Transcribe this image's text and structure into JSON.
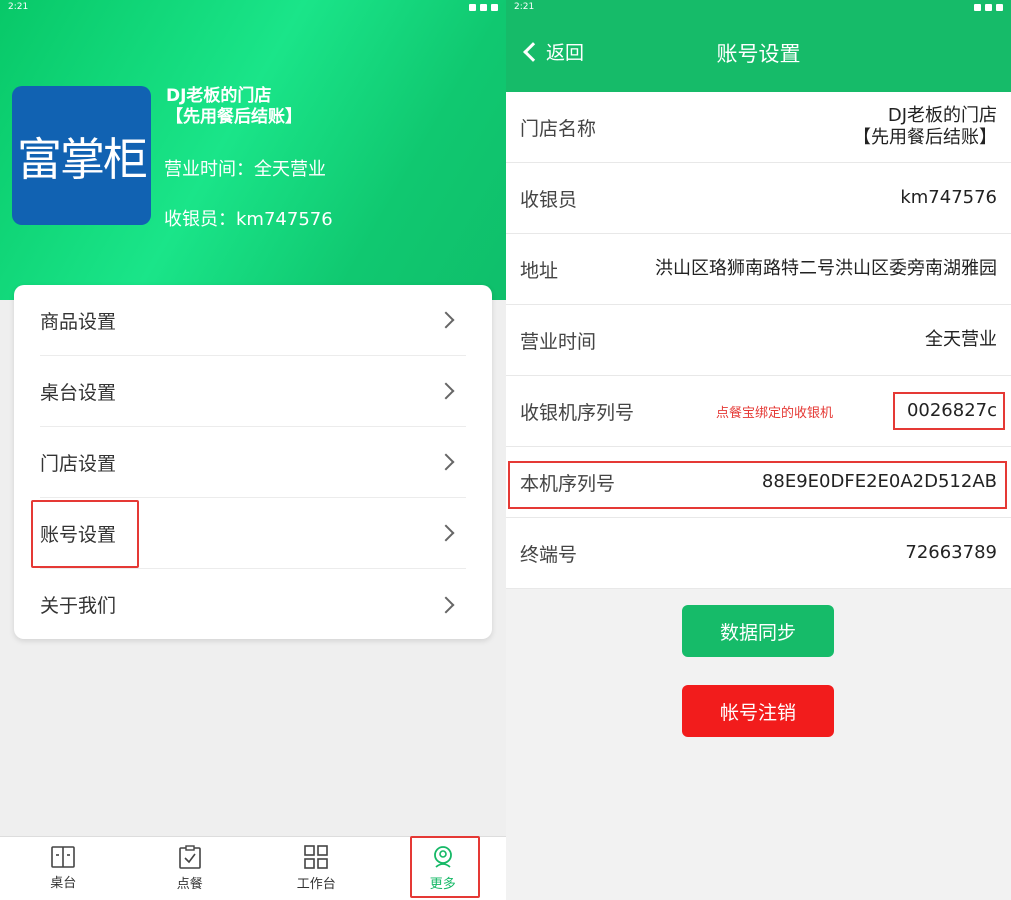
{
  "left": {
    "status": {
      "time": "2:21"
    },
    "header": {
      "logo_text": "富掌柜",
      "store_name_line1": "DJ老板的门店",
      "store_name_line2": "【先用餐后结账】",
      "hours": "营业时间：全天营业",
      "cashier": "收银员：km747576"
    },
    "menu": [
      {
        "label": "商品设置"
      },
      {
        "label": "桌台设置"
      },
      {
        "label": "门店设置"
      },
      {
        "label": "账号设置"
      },
      {
        "label": "关于我们"
      }
    ],
    "tabs": [
      {
        "label": "桌台"
      },
      {
        "label": "点餐"
      },
      {
        "label": "工作台"
      },
      {
        "label": "更多"
      }
    ]
  },
  "right": {
    "status": {
      "time": "2:21"
    },
    "nav": {
      "back": "返回",
      "title": "账号设置"
    },
    "rows": [
      {
        "label": "门店名称",
        "value1": "DJ老板的门店",
        "value2": "【先用餐后结账】"
      },
      {
        "label": "收银员",
        "value": "km747576"
      },
      {
        "label": "地址",
        "value": "洪山区珞狮南路特二号洪山区委旁南湖雅园"
      },
      {
        "label": "营业时间",
        "value": "全天营业"
      },
      {
        "label": "收银机序列号",
        "note": "点餐宝绑定的收银机",
        "value": "0026827c"
      },
      {
        "label": "本机序列号",
        "value": "88E9E0DFE2E0A2D512AB"
      },
      {
        "label": "终端号",
        "value": "72663789"
      }
    ],
    "buttons": {
      "sync": "数据同步",
      "logout": "帐号注销"
    }
  },
  "colors": {
    "primary_green": "#16bb69",
    "danger_red": "#f21c1c",
    "logo_blue": "#1162b2",
    "highlight_red": "#e53935"
  }
}
